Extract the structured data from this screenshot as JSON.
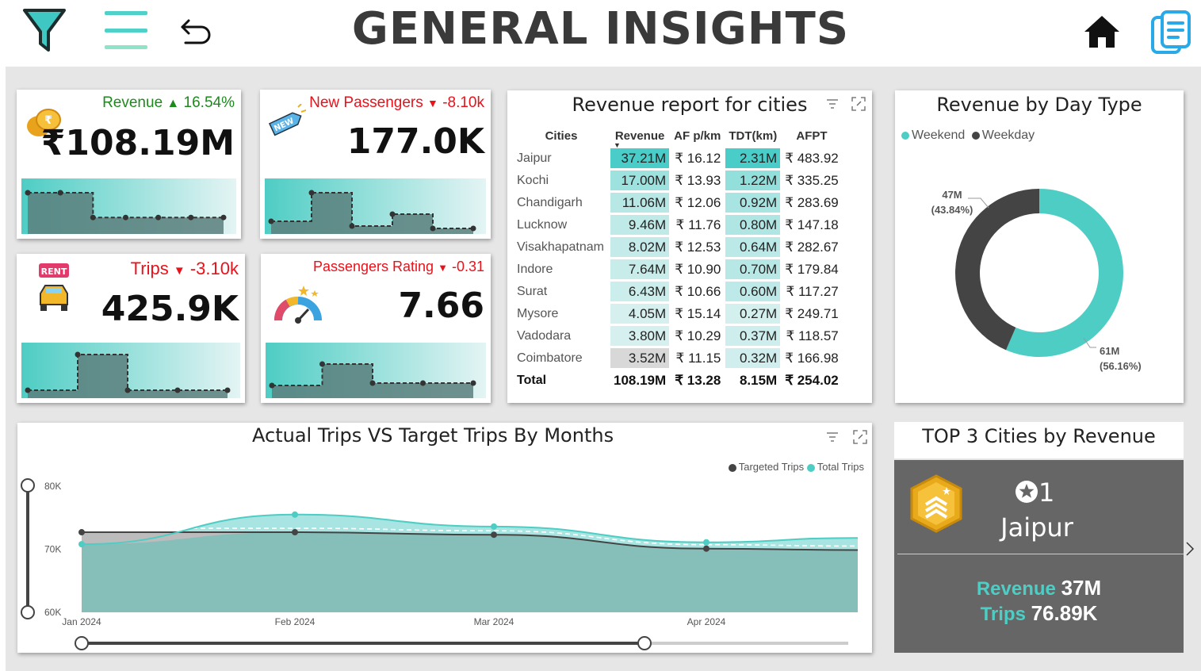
{
  "header": {
    "title": "GENERAL INSIGHTS",
    "icons": [
      "filter-icon",
      "menu-icon",
      "back-arrow-icon",
      "home-icon",
      "report-icon"
    ]
  },
  "kpis": {
    "revenue": {
      "label": "Revenue",
      "change": "16.54%",
      "value": "₹108.19M",
      "trend": "up"
    },
    "new_passengers": {
      "label": "New Passengers",
      "change": "-8.10k",
      "value": "177.0K",
      "trend": "down"
    },
    "trips": {
      "label": "Trips",
      "change": "-3.10k",
      "value": "425.9K",
      "trend": "down"
    },
    "rating": {
      "label": "Passengers Rating",
      "change": "-0.31",
      "value": "7.66",
      "trend": "down"
    }
  },
  "revenue_table": {
    "title": "Revenue report for cities",
    "columns": [
      "Cities",
      "Revenue",
      "AF p/km",
      "TDT(km)",
      "AFPT"
    ],
    "rows": [
      [
        "Jaipur",
        "37.21M",
        "₹ 16.12",
        "2.31M",
        "₹ 483.92"
      ],
      [
        "Kochi",
        "17.00M",
        "₹ 13.93",
        "1.22M",
        "₹ 335.25"
      ],
      [
        "Chandigarh",
        "11.06M",
        "₹ 12.06",
        "0.92M",
        "₹ 283.69"
      ],
      [
        "Lucknow",
        "9.46M",
        "₹ 11.76",
        "0.80M",
        "₹ 147.18"
      ],
      [
        "Visakhapatnam",
        "8.02M",
        "₹ 12.53",
        "0.64M",
        "₹ 282.67"
      ],
      [
        "Indore",
        "7.64M",
        "₹ 10.90",
        "0.70M",
        "₹ 179.84"
      ],
      [
        "Surat",
        "6.43M",
        "₹ 10.66",
        "0.60M",
        "₹ 117.27"
      ],
      [
        "Mysore",
        "4.05M",
        "₹ 15.14",
        "0.27M",
        "₹ 249.71"
      ],
      [
        "Vadodara",
        "3.80M",
        "₹ 10.29",
        "0.37M",
        "₹ 118.57"
      ],
      [
        "Coimbatore",
        "3.52M",
        "₹ 11.15",
        "0.32M",
        "₹ 166.98"
      ]
    ],
    "total": [
      "Total",
      "108.19M",
      "₹ 13.28",
      "8.15M",
      "₹ 254.02"
    ],
    "revenue_shade": [
      1.0,
      0.46,
      0.3,
      0.25,
      0.22,
      0.2,
      0.17,
      0.11,
      0.1,
      0.09
    ],
    "tdt_shade": [
      1.0,
      0.53,
      0.4,
      0.35,
      0.28,
      0.3,
      0.26,
      0.12,
      0.16,
      0.14
    ]
  },
  "day_type": {
    "title": "Revenue by Day Type",
    "legend": [
      {
        "name": "Weekend",
        "color": "#4ecdc4"
      },
      {
        "name": "Weekday",
        "color": "#444444"
      }
    ],
    "weekday_label": "47M",
    "weekday_pct": "(43.84%)",
    "weekend_label": "61M",
    "weekend_pct": "(56.16%)"
  },
  "trips_chart": {
    "title": "Actual Trips VS Target Trips By Months",
    "legend": [
      "Targeted Trips",
      "Total Trips"
    ]
  },
  "top3": {
    "title": "TOP 3 Cities by Revenue",
    "rank": "1",
    "city": "Jaipur",
    "revenue_label": "Revenue",
    "revenue_value": "37M",
    "trips_label": "Trips",
    "trips_value": "76.89K"
  },
  "chart_data": [
    {
      "type": "pie",
      "title": "Revenue by Day Type",
      "categories": [
        "Weekend",
        "Weekday"
      ],
      "values": [
        61,
        47
      ],
      "percent": [
        56.16,
        43.84
      ]
    },
    {
      "type": "line",
      "title": "Actual Trips VS Target Trips By Months",
      "categories": [
        "Jan 2024",
        "Feb 2024",
        "Mar 2024",
        "Apr 2024"
      ],
      "yticks": [
        "60K",
        "70K",
        "80K"
      ],
      "ylim": [
        60000,
        80000
      ],
      "series": [
        {
          "name": "Targeted Trips",
          "values": [
            72700,
            72700,
            72300,
            70100
          ]
        },
        {
          "name": "Total Trips",
          "values": [
            70800,
            75500,
            73600,
            71100
          ]
        }
      ],
      "legend_position": "top-right"
    },
    {
      "type": "area",
      "title": "Revenue",
      "values": [
        0.8,
        0.8,
        0.28,
        0.28,
        0.28,
        0.28
      ]
    },
    {
      "type": "area",
      "title": "New Passengers",
      "values": [
        0.2,
        0.8,
        0.1,
        0.35,
        0.05
      ]
    },
    {
      "type": "area",
      "title": "Trips",
      "values": [
        0.1,
        0.85,
        0.1,
        0.1
      ]
    },
    {
      "type": "area",
      "title": "Passengers Rating",
      "values": [
        0.2,
        0.65,
        0.25,
        0.25
      ]
    }
  ]
}
